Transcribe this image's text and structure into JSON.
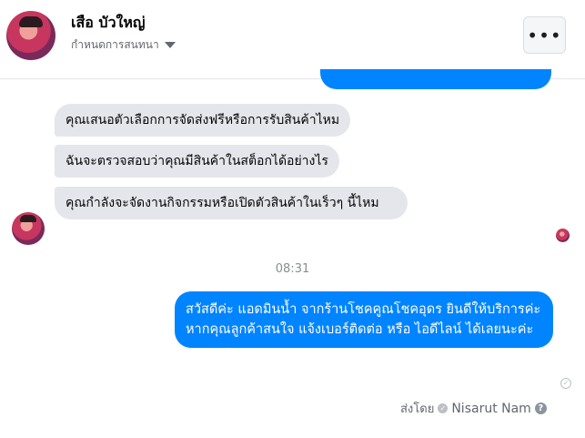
{
  "header": {
    "name": "เสือ บัวใหญ่",
    "subtitle": "กำหนดการสนทนา",
    "menu_icon": "more-horizontal-icon",
    "menu_label": "•••"
  },
  "messages": {
    "incoming": [
      "คุณเสนอตัวเลือกการจัดส่งฟรีหรือการรับสินค้าไหม",
      "ฉันจะตรวจสอบว่าคุณมีสินค้าในสต็อกได้อย่างไร",
      "คุณกำลังจะจัดงานกิจกรรมหรือเปิดตัวสินค้าในเร็วๆ นี้ไหม"
    ],
    "timestamp": "08:31",
    "outgoing_lines": [
      "สวัสดีค่ะ แอดมินน้ำ จากร้านโชคคูณโชคอุดร ยินดีให้บริการค่ะ",
      "หากคุณลูกค้าสนใจ แจ้งเบอร์ติดต่อ หรือ ไอดีไลน์ ได้เลยนะค่ะ"
    ]
  },
  "footer": {
    "sent_by_label": "ส่งโดย",
    "sender": "Nisarut Nam",
    "help_glyph": "?",
    "check_glyph": "✓"
  },
  "colors": {
    "accent": "#0084ff",
    "incoming_bg": "#e4e6eb"
  }
}
